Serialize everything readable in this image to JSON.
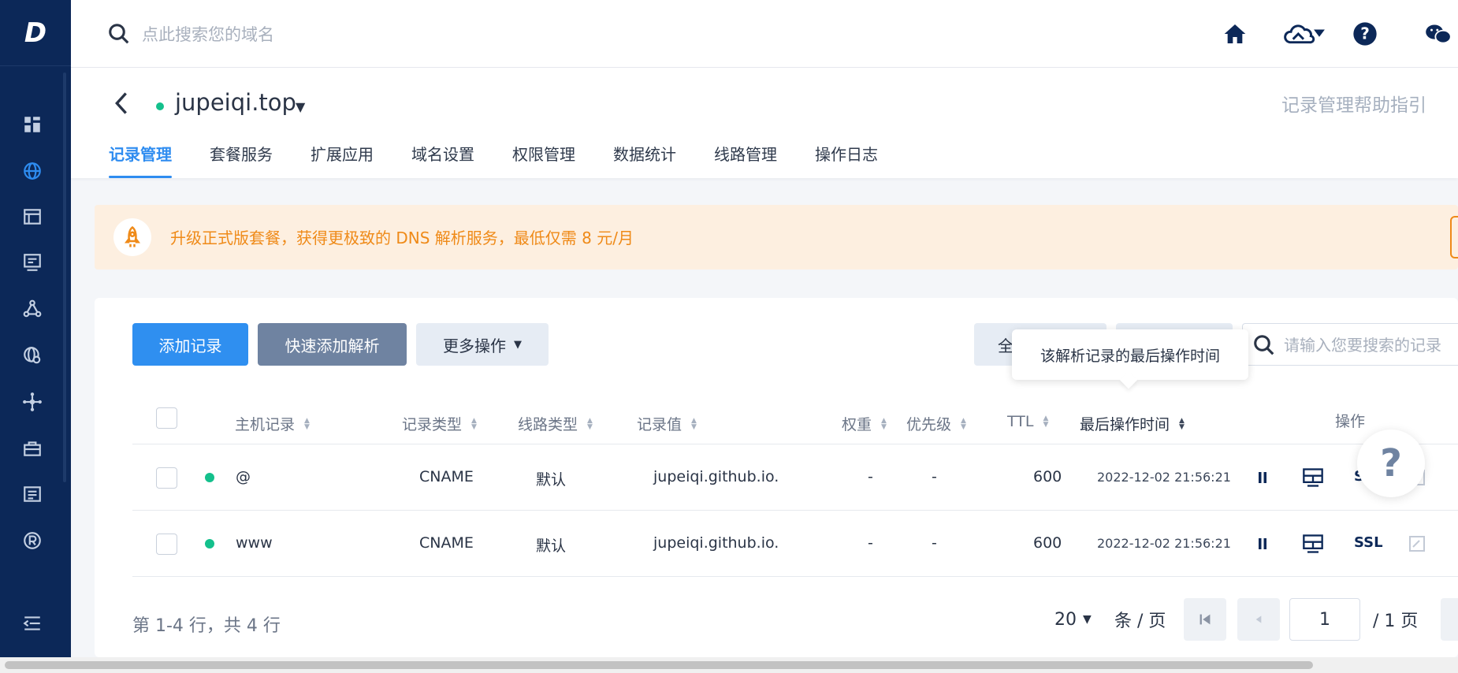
{
  "brand": {
    "logo": "D"
  },
  "sidebar": {
    "items": [
      "dashboard-icon",
      "globe-icon",
      "window-icon",
      "monitor-icon",
      "nodes-icon",
      "globe-settings-icon",
      "cluster-icon",
      "briefcase-icon",
      "document-icon",
      "registered-icon",
      "collapse-icon"
    ]
  },
  "topbar": {
    "search_placeholder": "点此搜索您的域名",
    "icons": [
      "home-icon",
      "cloud-icon",
      "help-icon",
      "wechat-icon"
    ]
  },
  "header": {
    "domain": "jupeiqi.top",
    "help_link": "记录管理帮助指引",
    "tabs": [
      "记录管理",
      "套餐服务",
      "扩展应用",
      "域名设置",
      "权限管理",
      "数据统计",
      "线路管理",
      "操作日志"
    ]
  },
  "banner": {
    "text": "升级正式版套餐，获得更极致的 DNS 解析服务，最低仅需 8 元/月"
  },
  "toolbar": {
    "add_label": "添加记录",
    "quick_add_label": "快速添加解析",
    "more_label": "更多操作",
    "filter1_label": "全",
    "search_placeholder": "请输入您要搜索的记录"
  },
  "tooltip": "该解析记录的最后操作时间",
  "table": {
    "columns": [
      "主机记录",
      "记录类型",
      "线路类型",
      "记录值",
      "权重",
      "优先级",
      "TTL",
      "最后操作时间",
      "操作"
    ],
    "rows": [
      {
        "host": "@",
        "type": "CNAME",
        "line": "默认",
        "value": "jupeiqi.github.io.",
        "weight": "-",
        "priority": "-",
        "ttl": "600",
        "time": "2022-12-02 21:56:21",
        "ssl": "S"
      },
      {
        "host": "www",
        "type": "CNAME",
        "line": "默认",
        "value": "jupeiqi.github.io.",
        "weight": "-",
        "priority": "-",
        "ttl": "600",
        "time": "2022-12-02 21:56:21",
        "ssl": "SSL"
      }
    ]
  },
  "footer": {
    "count": "第 1-4 行，共 4 行",
    "page_size": "20",
    "per_page": "条 / 页",
    "page_value": "1",
    "total_pages": "/ 1 页"
  },
  "float_help": "?",
  "colors": {
    "sidebar": "#0c2858",
    "accent": "#2e8cf0",
    "status": "#14c08c",
    "banner_text": "#ef8a18"
  }
}
